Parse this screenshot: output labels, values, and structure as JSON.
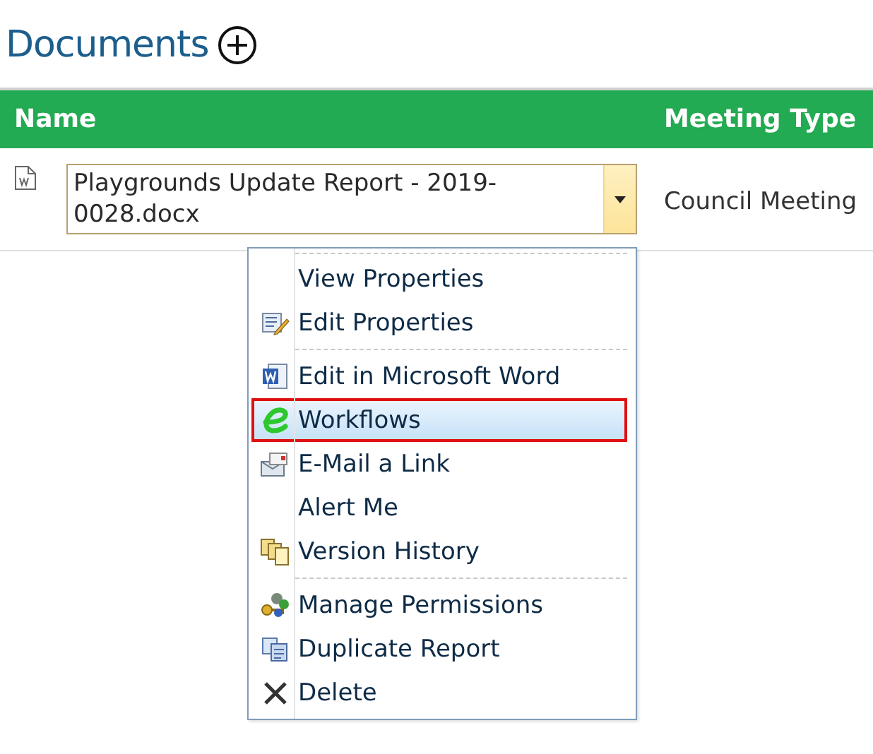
{
  "title": "Documents",
  "columns": [
    "Name",
    "Meeting Type"
  ],
  "row": {
    "name": "Playgrounds Update Report - 2019-0028.docx",
    "meeting_type": "Council Meeting"
  },
  "menu": {
    "groups": [
      {
        "items": [
          {
            "label": "View Properties",
            "kind": "none",
            "selected": false
          },
          {
            "label": "Edit Properties",
            "kind": "edit",
            "selected": false
          }
        ]
      },
      {
        "items": [
          {
            "label": "Edit in Microsoft Word",
            "kind": "word",
            "selected": false
          },
          {
            "label": "Workflows",
            "kind": "workflow",
            "selected": true
          },
          {
            "label": "E-Mail a Link",
            "kind": "email",
            "selected": false
          },
          {
            "label": "Alert Me",
            "kind": "none",
            "selected": false
          },
          {
            "label": "Version History",
            "kind": "versions",
            "selected": false
          }
        ]
      },
      {
        "items": [
          {
            "label": "Manage Permissions",
            "kind": "permissions",
            "selected": false
          },
          {
            "label": "Duplicate Report",
            "kind": "duplicate",
            "selected": false
          },
          {
            "label": "Delete",
            "kind": "delete",
            "selected": false
          }
        ]
      }
    ]
  }
}
